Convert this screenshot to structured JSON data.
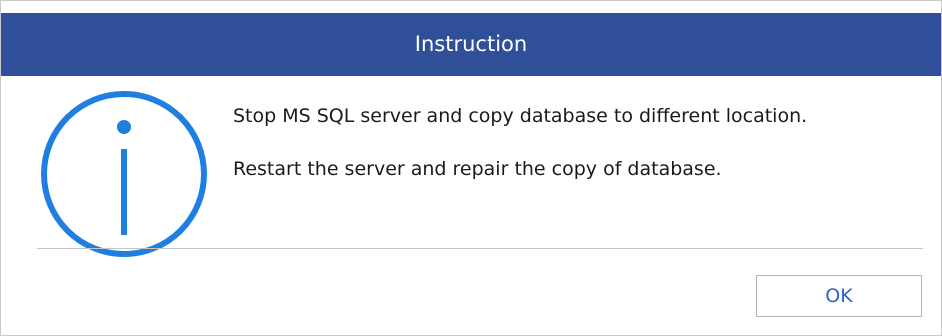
{
  "dialog": {
    "title": "Instruction",
    "icon": "info-icon",
    "messages": [
      "Stop MS SQL server and copy database to different location.",
      "Restart the server and repair the copy of database."
    ],
    "ok_label": "OK"
  },
  "colors": {
    "title_bar": "#2f4f99",
    "title_text": "#ffffff",
    "icon": "#1e7fe0",
    "ok_text": "#2d64c8",
    "divider": "#c6c6c6"
  }
}
